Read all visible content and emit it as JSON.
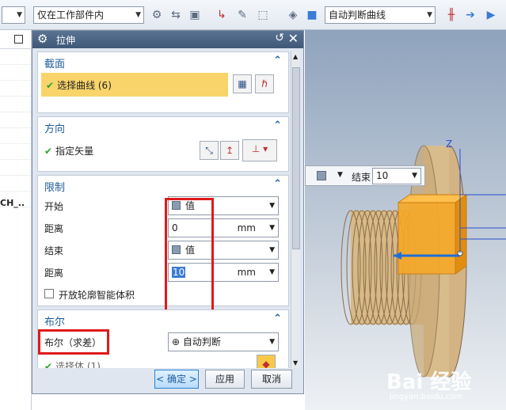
{
  "toolbar": {
    "filter_select": "仅在工作部件内",
    "curve_rule_select": "自动判断曲线"
  },
  "navigator": {
    "partial_text": "CH_.."
  },
  "dialog": {
    "title": "拉伸",
    "section": {
      "title": "截面",
      "row_label": "选择曲线 (6)"
    },
    "direction": {
      "title": "方向",
      "row_label": "指定矢量"
    },
    "limits": {
      "title": "限制",
      "start_label": "开始",
      "start_value": "值",
      "start_distance_label": "距离",
      "start_distance": "0",
      "start_unit": "mm",
      "end_label": "结束",
      "end_value": "值",
      "end_distance_label": "距离",
      "end_distance": "10",
      "end_unit": "mm",
      "open_profile_label": "开放轮廓智能体积"
    },
    "boolean": {
      "title": "布尔",
      "label": "布尔（求差）",
      "value": "自动判断",
      "select_body": "选择体 (1)"
    },
    "buttons": {
      "ok": "< 确定 >",
      "apply": "应用",
      "cancel": "取消"
    }
  },
  "viewport": {
    "end_label": "结束",
    "end_value": "10",
    "axis_label": "Z",
    "watermark": "Bai 经验",
    "watermark_url": "jingyan.baidu.com"
  }
}
